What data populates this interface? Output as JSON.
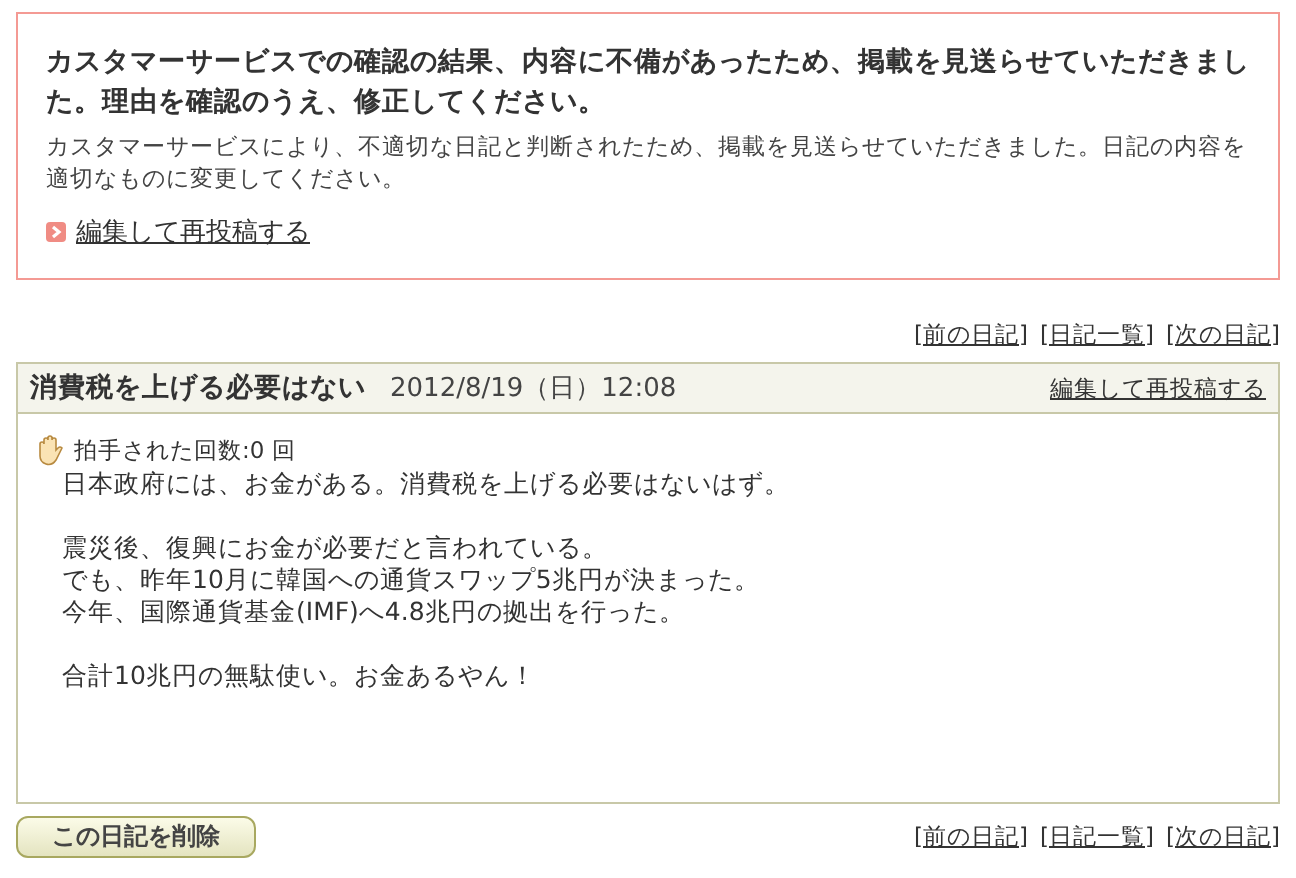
{
  "alert": {
    "title": "カスタマーサービスでの確認の結果、内容に不備があったため、掲載を見送らせていただきました。理由を確認のうえ、修正してください。",
    "message": "カスタマーサービスにより、不適切な日記と判断されたため、掲載を見送らせていただきました。日記の内容を適切なものに変更してください。",
    "link": "編集して再投稿する"
  },
  "nav_top": [
    {
      "open": "[",
      "label": "前の日記",
      "close": "]"
    },
    {
      "open": "[",
      "label": "日記一覧",
      "close": "]"
    },
    {
      "open": "[",
      "label": "次の日記",
      "close": "]"
    }
  ],
  "entry": {
    "title": "消費税を上げる必要はない",
    "date": "2012/8/19（日）12:08",
    "edit_link": "編集して再投稿する",
    "applause": "拍手された回数:0 回",
    "paragraphs": [
      [
        "日本政府には、お金がある。消費税を上げる必要はないはず。"
      ],
      [
        "震災後、復興にお金が必要だと言われている。",
        "でも、昨年10月に韓国への通貨スワップ5兆円が決まった。",
        "今年、国際通貨基金(IMF)へ4.8兆円の拠出を行った。"
      ],
      [
        "合計10兆円の無駄使い。お金あるやん！"
      ]
    ]
  },
  "delete_button": "この日記を削除",
  "nav_bottom": [
    {
      "open": "[",
      "label": "前の日記",
      "close": "]"
    },
    {
      "open": "[",
      "label": "日記一覧",
      "close": "]"
    },
    {
      "open": "[",
      "label": "次の日記",
      "close": "]"
    }
  ]
}
